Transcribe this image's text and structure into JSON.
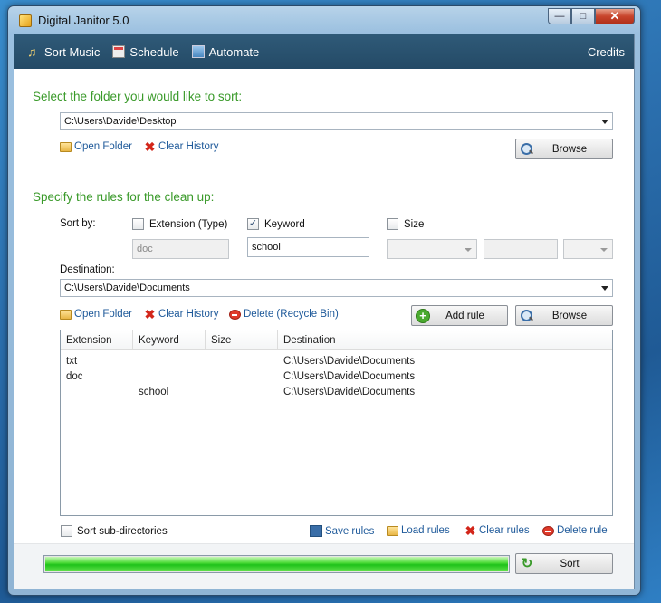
{
  "window": {
    "title": "Digital Janitor 5.0"
  },
  "nav": {
    "items": [
      {
        "label": "Sort Music",
        "icon": "music-note-icon"
      },
      {
        "label": "Schedule",
        "icon": "calendar-icon"
      },
      {
        "label": "Automate",
        "icon": "automate-icon"
      }
    ],
    "credits": "Credits"
  },
  "source": {
    "title": "Select the folder you would like to sort:",
    "folder": "C:\\Users\\Davide\\Desktop",
    "open_folder": "Open Folder",
    "clear_history": "Clear History",
    "browse": "Browse"
  },
  "rules": {
    "title": "Specify the rules for the clean up:",
    "sort_by": "Sort by:",
    "extension_label": "Extension (Type)",
    "extension_checked": false,
    "extension_placeholder": "doc",
    "keyword_label": "Keyword",
    "keyword_checked": true,
    "keyword_value": "school",
    "size_label": "Size",
    "size_checked": false,
    "destination_label": "Destination:",
    "destination": "C:\\Users\\Davide\\Documents",
    "open_folder": "Open Folder",
    "clear_history": "Clear History",
    "delete_recycle": "Delete (Recycle Bin)",
    "add_rule": "Add rule",
    "browse": "Browse"
  },
  "table": {
    "columns": [
      "Extension",
      "Keyword",
      "Size",
      "Destination",
      ""
    ],
    "rows": [
      [
        "txt",
        "",
        "",
        "C:\\Users\\Davide\\Documents"
      ],
      [
        "doc",
        "",
        "",
        "C:\\Users\\Davide\\Documents"
      ],
      [
        "",
        "school",
        "",
        "C:\\Users\\Davide\\Documents"
      ]
    ]
  },
  "footer": {
    "sort_subdirs": "Sort sub-directories",
    "sort_subdirs_checked": false,
    "save_rules": "Save rules",
    "load_rules": "Load rules",
    "clear_rules": "Clear rules",
    "delete_rule": "Delete rule"
  },
  "progress": {
    "value": 1.0
  },
  "sort_button": "Sort"
}
